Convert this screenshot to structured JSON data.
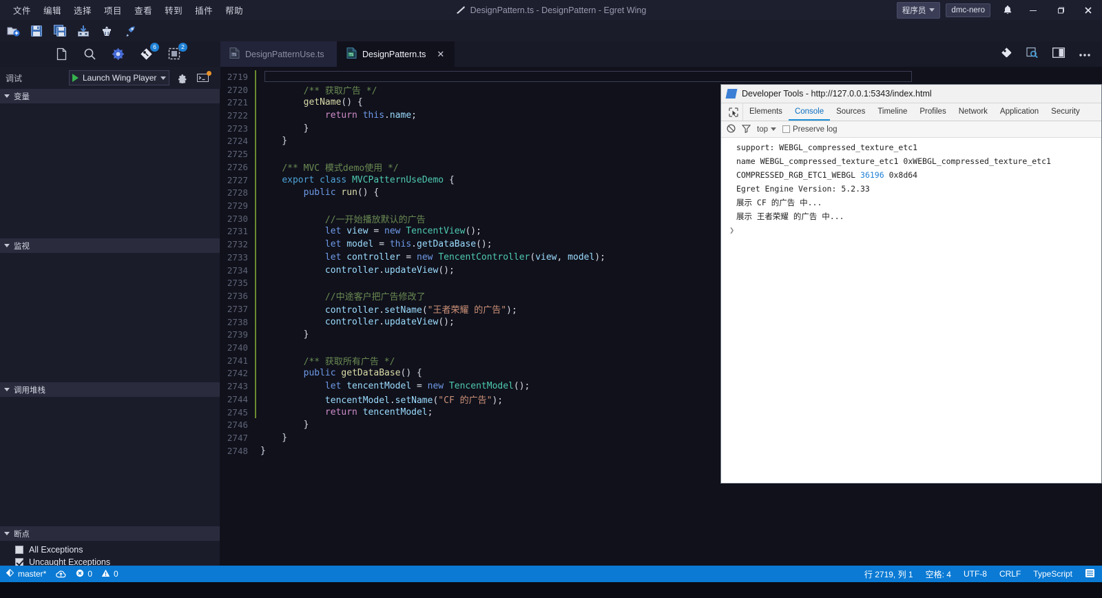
{
  "window": {
    "title": "DesignPattern.ts - DesignPattern - Egret Wing",
    "user_role": "程序员",
    "account": "dmc-nero",
    "minimize": "—",
    "maximize": "❐",
    "close": "✕"
  },
  "menu": [
    "文件",
    "编辑",
    "选择",
    "项目",
    "查看",
    "转到",
    "插件",
    "帮助"
  ],
  "toolbar": [
    {
      "name": "new-file-icon",
      "label": "新建文件"
    },
    {
      "name": "save-icon",
      "label": "保存"
    },
    {
      "name": "save-all-icon",
      "label": "全部保存"
    },
    {
      "name": "publish-icon",
      "label": "发布"
    },
    {
      "name": "build-icon",
      "label": "构建"
    },
    {
      "name": "run-icon",
      "label": "运行"
    }
  ],
  "activity": [
    {
      "name": "explorer-icon",
      "label": "资源管理器",
      "badge": ""
    },
    {
      "name": "search-icon",
      "label": "搜索",
      "badge": ""
    },
    {
      "name": "debug-icon",
      "label": "调试",
      "badge": ""
    },
    {
      "name": "source-control-icon",
      "label": "源代码管理",
      "badge": "6"
    },
    {
      "name": "extensions-icon",
      "label": "扩展",
      "badge": "2"
    }
  ],
  "debug": {
    "label": "调试",
    "configuration": "Launch Wing Player",
    "gear_title": "打开配置",
    "terminal_title": "调试控制台"
  },
  "sidebar": {
    "sections": [
      {
        "title": "变量",
        "id": "variables"
      },
      {
        "title": "监视",
        "id": "watch"
      },
      {
        "title": "调用堆栈",
        "id": "call-stack"
      },
      {
        "title": "断点",
        "id": "breakpoints"
      }
    ],
    "breakpoints": [
      {
        "label": "All Exceptions",
        "checked": false
      },
      {
        "label": "Uncaught Exceptions",
        "checked": true
      }
    ]
  },
  "tabs": [
    {
      "label": "DesignPatternUse.ts",
      "active": false,
      "icon": "typescript-file-icon",
      "closable": false
    },
    {
      "label": "DesignPattern.ts",
      "active": true,
      "icon": "typescript-file-icon",
      "closable": true
    }
  ],
  "tab_actions": [
    {
      "name": "split-diff-icon"
    },
    {
      "name": "preview-icon"
    },
    {
      "name": "split-editor-icon"
    },
    {
      "name": "more-actions-icon"
    }
  ],
  "editor": {
    "first_line": 2719,
    "lines": [
      {
        "no": 2719,
        "guide": true,
        "cursor": true,
        "tokens": []
      },
      {
        "no": 2720,
        "guide": true,
        "tokens": [
          {
            "t": "        ",
            "c": "pn"
          },
          {
            "t": "/** 获取广告 */",
            "c": "cm"
          }
        ]
      },
      {
        "no": 2721,
        "guide": true,
        "tokens": [
          {
            "t": "        ",
            "c": "pn"
          },
          {
            "t": "getName",
            "c": "fn"
          },
          {
            "t": "() {",
            "c": "pn"
          }
        ]
      },
      {
        "no": 2722,
        "guide": true,
        "tokens": [
          {
            "t": "            ",
            "c": "pn"
          },
          {
            "t": "return",
            "c": "pl"
          },
          {
            "t": " ",
            "c": "pn"
          },
          {
            "t": "this",
            "c": "kw"
          },
          {
            "t": ".",
            "c": "pn"
          },
          {
            "t": "name",
            "c": "var"
          },
          {
            "t": ";",
            "c": "pn"
          }
        ]
      },
      {
        "no": 2723,
        "guide": true,
        "tokens": [
          {
            "t": "        }",
            "c": "pn"
          }
        ]
      },
      {
        "no": 2724,
        "guide": true,
        "tokens": [
          {
            "t": "    }",
            "c": "pn"
          }
        ]
      },
      {
        "no": 2725,
        "guide": true,
        "tokens": []
      },
      {
        "no": 2726,
        "guide": true,
        "tokens": [
          {
            "t": "    ",
            "c": "pn"
          },
          {
            "t": "/** MVC 模式demo使用 */",
            "c": "cm"
          }
        ]
      },
      {
        "no": 2727,
        "guide": true,
        "tokens": [
          {
            "t": "    ",
            "c": "pn"
          },
          {
            "t": "export",
            "c": "kw2"
          },
          {
            "t": " ",
            "c": "pn"
          },
          {
            "t": "class",
            "c": "kw2"
          },
          {
            "t": " ",
            "c": "pn"
          },
          {
            "t": "MVCPatternUseDemo",
            "c": "typ"
          },
          {
            "t": " {",
            "c": "pn"
          }
        ]
      },
      {
        "no": 2728,
        "guide": true,
        "tokens": [
          {
            "t": "        ",
            "c": "pn"
          },
          {
            "t": "public",
            "c": "kw"
          },
          {
            "t": " ",
            "c": "pn"
          },
          {
            "t": "run",
            "c": "fn"
          },
          {
            "t": "() {",
            "c": "pn"
          }
        ]
      },
      {
        "no": 2729,
        "guide": true,
        "tokens": []
      },
      {
        "no": 2730,
        "guide": true,
        "tokens": [
          {
            "t": "            ",
            "c": "pn"
          },
          {
            "t": "//一开始播放默认的广告",
            "c": "cm"
          }
        ]
      },
      {
        "no": 2731,
        "guide": true,
        "tokens": [
          {
            "t": "            ",
            "c": "pn"
          },
          {
            "t": "let",
            "c": "kw"
          },
          {
            "t": " ",
            "c": "pn"
          },
          {
            "t": "view",
            "c": "var"
          },
          {
            "t": " = ",
            "c": "pn"
          },
          {
            "t": "new",
            "c": "kw"
          },
          {
            "t": " ",
            "c": "pn"
          },
          {
            "t": "TencentView",
            "c": "typ"
          },
          {
            "t": "();",
            "c": "pn"
          }
        ]
      },
      {
        "no": 2732,
        "guide": true,
        "tokens": [
          {
            "t": "            ",
            "c": "pn"
          },
          {
            "t": "let",
            "c": "kw"
          },
          {
            "t": " ",
            "c": "pn"
          },
          {
            "t": "model",
            "c": "var"
          },
          {
            "t": " = ",
            "c": "pn"
          },
          {
            "t": "this",
            "c": "kw"
          },
          {
            "t": ".",
            "c": "pn"
          },
          {
            "t": "getDataBase",
            "c": "var"
          },
          {
            "t": "();",
            "c": "pn"
          }
        ]
      },
      {
        "no": 2733,
        "guide": true,
        "tokens": [
          {
            "t": "            ",
            "c": "pn"
          },
          {
            "t": "let",
            "c": "kw"
          },
          {
            "t": " ",
            "c": "pn"
          },
          {
            "t": "controller",
            "c": "var"
          },
          {
            "t": " = ",
            "c": "pn"
          },
          {
            "t": "new",
            "c": "kw"
          },
          {
            "t": " ",
            "c": "pn"
          },
          {
            "t": "TencentController",
            "c": "typ"
          },
          {
            "t": "(",
            "c": "pn"
          },
          {
            "t": "view",
            "c": "var"
          },
          {
            "t": ", ",
            "c": "pn"
          },
          {
            "t": "model",
            "c": "var"
          },
          {
            "t": ");",
            "c": "pn"
          }
        ]
      },
      {
        "no": 2734,
        "guide": true,
        "tokens": [
          {
            "t": "            ",
            "c": "pn"
          },
          {
            "t": "controller",
            "c": "var"
          },
          {
            "t": ".",
            "c": "pn"
          },
          {
            "t": "updateView",
            "c": "var"
          },
          {
            "t": "();",
            "c": "pn"
          }
        ]
      },
      {
        "no": 2735,
        "guide": true,
        "tokens": []
      },
      {
        "no": 2736,
        "guide": true,
        "tokens": [
          {
            "t": "            ",
            "c": "pn"
          },
          {
            "t": "//中途客户把广告修改了",
            "c": "cm"
          }
        ]
      },
      {
        "no": 2737,
        "guide": true,
        "tokens": [
          {
            "t": "            ",
            "c": "pn"
          },
          {
            "t": "controller",
            "c": "var"
          },
          {
            "t": ".",
            "c": "pn"
          },
          {
            "t": "setName",
            "c": "var"
          },
          {
            "t": "(",
            "c": "pn"
          },
          {
            "t": "\"王者荣耀 的广告\"",
            "c": "str"
          },
          {
            "t": ");",
            "c": "pn"
          }
        ]
      },
      {
        "no": 2738,
        "guide": true,
        "tokens": [
          {
            "t": "            ",
            "c": "pn"
          },
          {
            "t": "controller",
            "c": "var"
          },
          {
            "t": ".",
            "c": "pn"
          },
          {
            "t": "updateView",
            "c": "var"
          },
          {
            "t": "();",
            "c": "pn"
          }
        ]
      },
      {
        "no": 2739,
        "guide": true,
        "tokens": [
          {
            "t": "        }",
            "c": "pn"
          }
        ]
      },
      {
        "no": 2740,
        "guide": true,
        "tokens": []
      },
      {
        "no": 2741,
        "guide": true,
        "tokens": [
          {
            "t": "        ",
            "c": "pn"
          },
          {
            "t": "/** 获取所有广告 */",
            "c": "cm"
          }
        ]
      },
      {
        "no": 2742,
        "guide": true,
        "tokens": [
          {
            "t": "        ",
            "c": "pn"
          },
          {
            "t": "public",
            "c": "kw"
          },
          {
            "t": " ",
            "c": "pn"
          },
          {
            "t": "getDataBase",
            "c": "fn"
          },
          {
            "t": "() {",
            "c": "pn"
          }
        ]
      },
      {
        "no": 2743,
        "guide": true,
        "tokens": [
          {
            "t": "            ",
            "c": "pn"
          },
          {
            "t": "let",
            "c": "kw"
          },
          {
            "t": " ",
            "c": "pn"
          },
          {
            "t": "tencentModel",
            "c": "var"
          },
          {
            "t": " = ",
            "c": "pn"
          },
          {
            "t": "new",
            "c": "kw"
          },
          {
            "t": " ",
            "c": "pn"
          },
          {
            "t": "TencentModel",
            "c": "typ"
          },
          {
            "t": "();",
            "c": "pn"
          }
        ]
      },
      {
        "no": 2744,
        "guide": true,
        "tokens": [
          {
            "t": "            ",
            "c": "pn"
          },
          {
            "t": "tencentModel",
            "c": "var"
          },
          {
            "t": ".",
            "c": "pn"
          },
          {
            "t": "setName",
            "c": "var"
          },
          {
            "t": "(",
            "c": "pn"
          },
          {
            "t": "\"CF 的广告\"",
            "c": "str"
          },
          {
            "t": ");",
            "c": "pn"
          }
        ]
      },
      {
        "no": 2745,
        "guide": true,
        "tokens": [
          {
            "t": "            ",
            "c": "pn"
          },
          {
            "t": "return",
            "c": "pl"
          },
          {
            "t": " ",
            "c": "pn"
          },
          {
            "t": "tencentModel",
            "c": "var"
          },
          {
            "t": ";",
            "c": "pn"
          }
        ]
      },
      {
        "no": 2746,
        "guide": false,
        "tokens": [
          {
            "t": "        }",
            "c": "pn"
          }
        ]
      },
      {
        "no": 2747,
        "guide": false,
        "tokens": [
          {
            "t": "    }",
            "c": "pn"
          }
        ]
      },
      {
        "no": 2748,
        "guide": false,
        "tokens": [
          {
            "t": "}",
            "c": "pn"
          }
        ]
      }
    ]
  },
  "devtools": {
    "title": "Developer Tools - http://127.0.0.1:5343/index.html",
    "tabs": [
      "Elements",
      "Console",
      "Sources",
      "Timeline",
      "Profiles",
      "Network",
      "Application",
      "Security"
    ],
    "active_tab": "Console",
    "filter": {
      "clear_title": "Clear console",
      "filter_title": "Filter",
      "context": "top",
      "preserve_log": "Preserve log",
      "preserve_log_checked": false
    },
    "console_lines": [
      [
        {
          "t": "support: WEBGL_compressed_texture_etc1",
          "c": "plain"
        }
      ],
      [
        {
          "t": "name WEBGL_compressed_texture_etc1 0xWEBGL_compressed_texture_etc1",
          "c": "plain"
        }
      ],
      [
        {
          "t": "COMPRESSED_RGB_ETC1_WEBGL ",
          "c": "plain"
        },
        {
          "t": "36196",
          "c": "num2"
        },
        {
          "t": " 0x8d64",
          "c": "plain"
        }
      ],
      [
        {
          "t": "Egret Engine Version: 5.2.33",
          "c": "plain"
        }
      ],
      [
        {
          "t": "展示 CF 的广告 中...",
          "c": "plain"
        }
      ],
      [
        {
          "t": "展示 王者荣耀 的广告 中...",
          "c": "plain"
        }
      ]
    ],
    "prompt": "❯"
  },
  "statusbar": {
    "branch": "master*",
    "sync_title": "同步",
    "errors": "0",
    "warnings": "0",
    "position": "行 2719, 列 1",
    "indent": "空格: 4",
    "encoding": "UTF-8",
    "eol": "CRLF",
    "language": "TypeScript",
    "feedback_title": "反馈"
  },
  "colors": {
    "accent": "#0a7ad4",
    "titlebar_bg": "#1d1e2e",
    "sidebar_bg": "#1b1c2a",
    "editor_bg": "#10111b",
    "badge": "#1e7fd4",
    "guide_green": "#6c8c2e",
    "devtools_accent": "#1b8fd6"
  }
}
